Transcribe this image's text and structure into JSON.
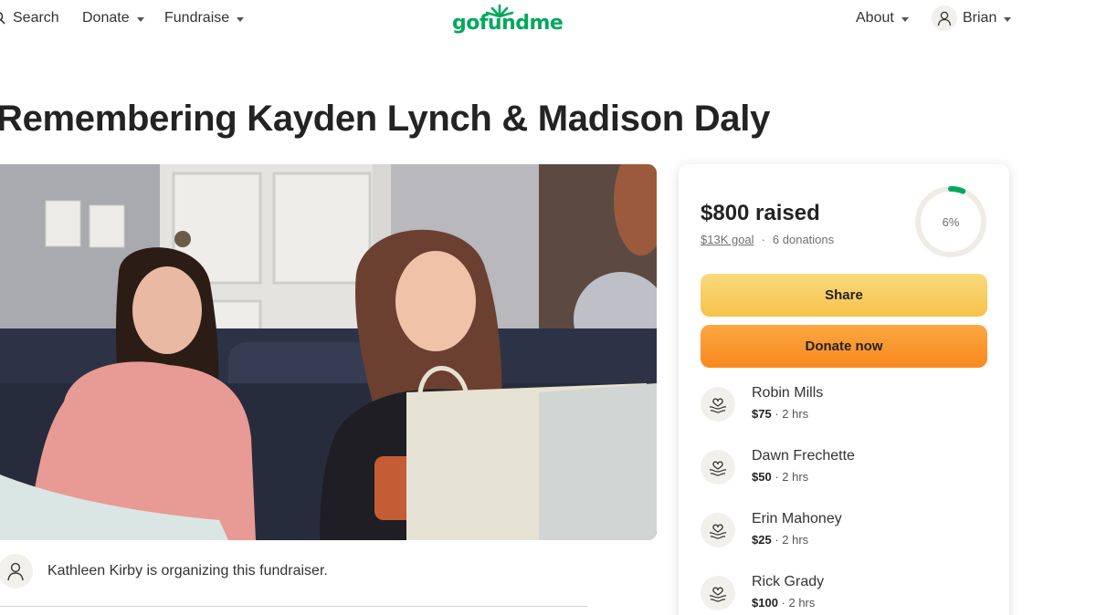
{
  "nav": {
    "search_label": "Search",
    "donate_label": "Donate",
    "fundraise_label": "Fundraise",
    "logo_text": "gofundme",
    "about_label": "About",
    "user_label": "Brian"
  },
  "colors": {
    "brand_green": "#02a95c",
    "share_button": "#f6c24b",
    "donate_button": "#f8891d"
  },
  "campaign": {
    "title": "Remembering Kayden Lynch & Madison Daly",
    "organizer_text": "Kathleen Kirby is organizing this fundraiser."
  },
  "donation_card": {
    "raised": "$800 raised",
    "goal": "$13K goal",
    "separator": "·",
    "donations": "6 donations",
    "progress_label": "6%",
    "progress_fraction": 0.06,
    "share_label": "Share",
    "donate_label": "Donate now",
    "recent_donors": [
      {
        "name": "Robin Mills",
        "amount": "$75",
        "time": " · 2 hrs"
      },
      {
        "name": "Dawn Frechette",
        "amount": "$50",
        "time": " · 2 hrs"
      },
      {
        "name": "Erin Mahoney",
        "amount": "$25",
        "time": " · 2 hrs"
      },
      {
        "name": "Rick Grady",
        "amount": "$100",
        "time": " · 2 hrs"
      }
    ]
  },
  "icons": [
    "search-icon",
    "sun-logo-icon",
    "user-icon",
    "donation-hands-icon"
  ]
}
